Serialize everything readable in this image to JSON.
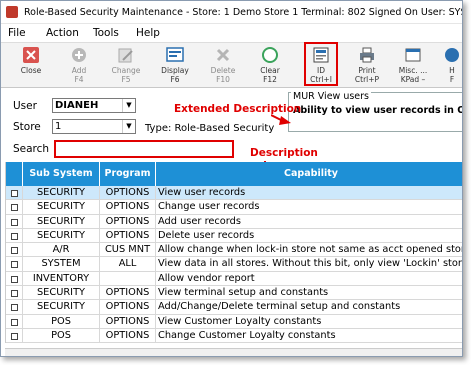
{
  "window": {
    "title": "Role-Based Security Maintenance - Store: 1  Demo Store 1  Terminal: 802  Signed On User: SYSTEM"
  },
  "menu": [
    "File",
    "Action",
    "Tools",
    "Help"
  ],
  "toolbar": [
    {
      "label": "Close",
      "key": "",
      "icon": "close-icon"
    },
    {
      "label": "Add",
      "key": "F4",
      "icon": "add-icon"
    },
    {
      "label": "Change",
      "key": "F5",
      "icon": "edit-icon"
    },
    {
      "label": "Display",
      "key": "F6",
      "icon": "display-icon"
    },
    {
      "label": "Delete",
      "key": "F10",
      "icon": "delete-icon"
    },
    {
      "label": "Clear",
      "key": "F12",
      "icon": "clear-icon"
    },
    {
      "label": "ID",
      "key": "Ctrl+I",
      "icon": "id-icon"
    },
    {
      "label": "Print",
      "key": "Ctrl+P",
      "icon": "print-icon"
    },
    {
      "label": "Misc. ...",
      "key": "KPad –",
      "icon": "misc-icon"
    },
    {
      "label": "H",
      "key": "F",
      "icon": "help-icon"
    }
  ],
  "form": {
    "user_label": "User",
    "user_value": "DIANEH",
    "store_label": "Store",
    "store_value": "1",
    "type_text": "Type: Role-Based Security",
    "search_label": "Search",
    "search_value": ""
  },
  "info": {
    "title": "MUR View users",
    "text": "Ability to view user records in Optio Configuration or Legacy Function M"
  },
  "annotations": {
    "extended": "Extended Description",
    "description": "Description"
  },
  "grid": {
    "headers": [
      "",
      "Sub System",
      "Program",
      "Capability"
    ],
    "rows": [
      {
        "sub": "SECURITY",
        "prog": "OPTIONS",
        "cap": "View user records",
        "sel": true
      },
      {
        "sub": "SECURITY",
        "prog": "OPTIONS",
        "cap": "Change user records"
      },
      {
        "sub": "SECURITY",
        "prog": "OPTIONS",
        "cap": "Add user records"
      },
      {
        "sub": "SECURITY",
        "prog": "OPTIONS",
        "cap": "Delete user records"
      },
      {
        "sub": "A/R",
        "prog": "CUS MNT",
        "cap": "Allow change when lock-in store not same as acct opened store"
      },
      {
        "sub": "SYSTEM",
        "prog": "ALL",
        "cap": "View data in all stores. Without this bit, only view 'Lockin' store data"
      },
      {
        "sub": "INVENTORY",
        "prog": "",
        "cap": "Allow vendor report"
      },
      {
        "sub": "SECURITY",
        "prog": "OPTIONS",
        "cap": "View terminal setup and constants"
      },
      {
        "sub": "SECURITY",
        "prog": "OPTIONS",
        "cap": "Add/Change/Delete terminal setup and constants"
      },
      {
        "sub": "POS",
        "prog": "OPTIONS",
        "cap": "View Customer Loyalty constants"
      },
      {
        "sub": "POS",
        "prog": "OPTIONS",
        "cap": "Change Customer Loyalty constants"
      }
    ]
  },
  "colors": {
    "accent": "#1e90d6",
    "annotation": "#e00000",
    "selected_row": "#cde8fb"
  }
}
